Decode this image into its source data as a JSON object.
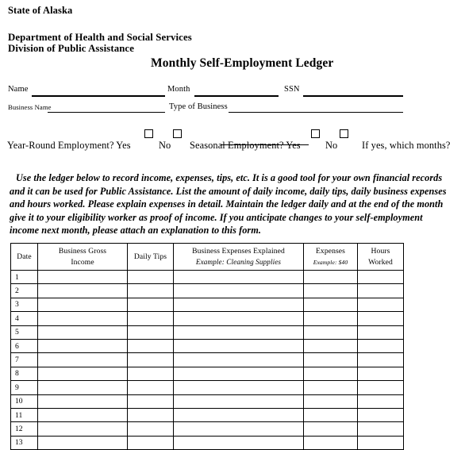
{
  "document": {
    "agency_state": "State of Alaska",
    "department": "Department of Health and Social Services",
    "division": "Division of Public Assistance",
    "title": "Monthly Self-Employment Ledger"
  },
  "fields": {
    "name_label": "Name",
    "name_value": "",
    "month_label": "Month",
    "month_value": "",
    "ssn_label": "SSN",
    "ssn_value": "",
    "business_name_label": "Business Name",
    "business_name_value": "",
    "type_of_business_label": "Type of Business",
    "type_of_business_value": ""
  },
  "employment": {
    "year_round_question": "Year-Round Employment? Yes",
    "year_round_no": "No",
    "seasonal_question": "Seasonal Employment? Yes",
    "seasonal_no": "No",
    "which_months": "If yes, which months?",
    "checkbox_year_round_yes_checked": false,
    "checkbox_year_round_no_checked": false,
    "checkbox_seasonal_yes_checked": false,
    "checkbox_seasonal_no_checked": false
  },
  "instructions": {
    "text": "Use the ledger below to record income, expenses, tips, etc. It is a good tool for your own financial records and it can be used for Public Assistance. List the amount of daily income, daily tips, daily business expenses and hours worked. Please explain expenses in detail. Maintain the ledger daily and at the end of the month give it to your eligibility worker as proof of income. If you anticipate changes to your self-employment income next month, please attach an explanation to this form."
  },
  "ledger": {
    "columns": [
      {
        "line1": "Date",
        "line2": "",
        "example": ""
      },
      {
        "line1": "Business Gross",
        "line2": "Income",
        "example": ""
      },
      {
        "line1": "Daily Tips",
        "line2": "",
        "example": ""
      },
      {
        "line1": "Business Expenses Explained",
        "line2": "",
        "example": "Example: Cleaning Supplies"
      },
      {
        "line1": "Expenses",
        "line2": "",
        "example": "Example: $40"
      },
      {
        "line1": "Hours",
        "line2": "Worked",
        "example": ""
      }
    ],
    "rows": [
      {
        "date": "1",
        "gross": "",
        "tips": "",
        "explained": "",
        "expenses": "",
        "hours": ""
      },
      {
        "date": "2",
        "gross": "",
        "tips": "",
        "explained": "",
        "expenses": "",
        "hours": ""
      },
      {
        "date": "3",
        "gross": "",
        "tips": "",
        "explained": "",
        "expenses": "",
        "hours": ""
      },
      {
        "date": "4",
        "gross": "",
        "tips": "",
        "explained": "",
        "expenses": "",
        "hours": ""
      },
      {
        "date": "5",
        "gross": "",
        "tips": "",
        "explained": "",
        "expenses": "",
        "hours": ""
      },
      {
        "date": "6",
        "gross": "",
        "tips": "",
        "explained": "",
        "expenses": "",
        "hours": ""
      },
      {
        "date": "7",
        "gross": "",
        "tips": "",
        "explained": "",
        "expenses": "",
        "hours": ""
      },
      {
        "date": "8",
        "gross": "",
        "tips": "",
        "explained": "",
        "expenses": "",
        "hours": ""
      },
      {
        "date": "9",
        "gross": "",
        "tips": "",
        "explained": "",
        "expenses": "",
        "hours": ""
      },
      {
        "date": "10",
        "gross": "",
        "tips": "",
        "explained": "",
        "expenses": "",
        "hours": ""
      },
      {
        "date": "11",
        "gross": "",
        "tips": "",
        "explained": "",
        "expenses": "",
        "hours": ""
      },
      {
        "date": "12",
        "gross": "",
        "tips": "",
        "explained": "",
        "expenses": "",
        "hours": ""
      },
      {
        "date": "13",
        "gross": "",
        "tips": "",
        "explained": "",
        "expenses": "",
        "hours": ""
      }
    ]
  },
  "colors": {
    "ink": "#000000",
    "paper": "#ffffff"
  }
}
